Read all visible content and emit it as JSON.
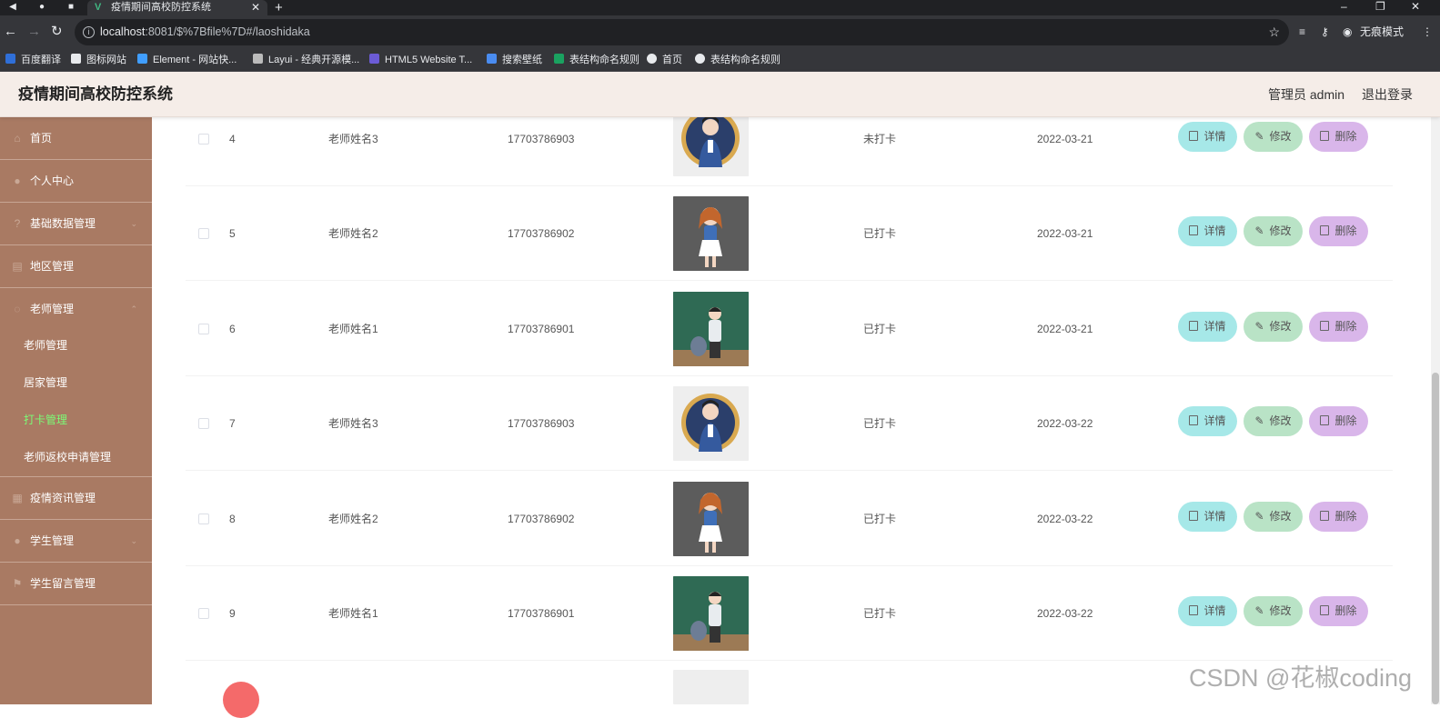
{
  "browser": {
    "tab_title": "疫情期间高校防控系统",
    "url_host": "localhost",
    "url_rest": ":8081/$%7Bfile%7D#/laoshidaka",
    "incognito_label": "无痕模式",
    "bookmarks": [
      {
        "label": "百度翻译",
        "color": "#2f6fd8"
      },
      {
        "label": "图标网站",
        "color": "#e8eaed"
      },
      {
        "label": "Element - 网站快...",
        "color": "#409eff"
      },
      {
        "label": "Layui - 经典开源模...",
        "color": "#bbbbbb"
      },
      {
        "label": "HTML5 Website T...",
        "color": "#6b5bd6"
      },
      {
        "label": "搜索壁纸",
        "color": "#4a8cf0"
      },
      {
        "label": "表结构命名规则",
        "color": "#1aa260"
      },
      {
        "label": "首页",
        "color": "#e8eaed"
      },
      {
        "label": "表结构命名规则",
        "color": "#e8eaed"
      }
    ]
  },
  "header": {
    "title": "疫情期间高校防控系统",
    "user": "管理员 admin",
    "logout": "退出登录"
  },
  "sidebar": {
    "items": [
      {
        "label": "首页",
        "icon": "home-icon"
      },
      {
        "label": "个人中心",
        "icon": "user-icon"
      },
      {
        "label": "基础数据管理",
        "icon": "help-icon"
      },
      {
        "label": "地区管理",
        "icon": "doc-icon"
      },
      {
        "label": "老师管理",
        "icon": "group-icon"
      }
    ],
    "sub_items": [
      {
        "label": "老师管理"
      },
      {
        "label": "居家管理"
      },
      {
        "label": "打卡管理"
      },
      {
        "label": "老师返校申请管理"
      }
    ],
    "items_after": [
      {
        "label": "疫情资讯管理",
        "icon": "news-icon"
      },
      {
        "label": "学生管理",
        "icon": "student-icon"
      },
      {
        "label": "学生留言管理",
        "icon": "flag-icon"
      }
    ]
  },
  "table": {
    "rows": [
      {
        "index": "4",
        "name": "老师姓名3",
        "phone": "17703786903",
        "status": "未打卡",
        "date": "2022-03-21",
        "avatar": "t3"
      },
      {
        "index": "5",
        "name": "老师姓名2",
        "phone": "17703786902",
        "status": "已打卡",
        "date": "2022-03-21",
        "avatar": "t2"
      },
      {
        "index": "6",
        "name": "老师姓名1",
        "phone": "17703786901",
        "status": "已打卡",
        "date": "2022-03-21",
        "avatar": "t1"
      },
      {
        "index": "7",
        "name": "老师姓名3",
        "phone": "17703786903",
        "status": "已打卡",
        "date": "2022-03-22",
        "avatar": "t3"
      },
      {
        "index": "8",
        "name": "老师姓名2",
        "phone": "17703786902",
        "status": "已打卡",
        "date": "2022-03-22",
        "avatar": "t2"
      },
      {
        "index": "9",
        "name": "老师姓名1",
        "phone": "17703786901",
        "status": "已打卡",
        "date": "2022-03-22",
        "avatar": "t1"
      }
    ],
    "actions": {
      "detail": "详情",
      "edit": "修改",
      "delete": "删除"
    }
  },
  "watermark": "CSDN @花椒coding"
}
